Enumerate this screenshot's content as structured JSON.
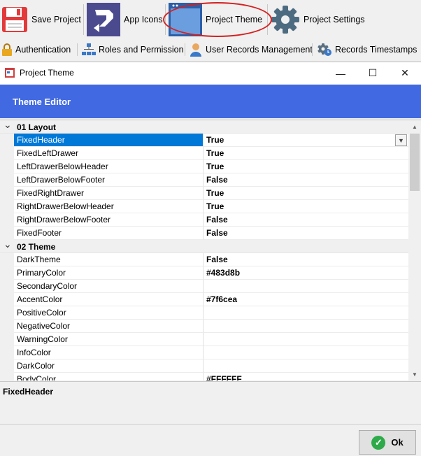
{
  "ribbon": {
    "row1": [
      {
        "label": "Save Project",
        "icon": "floppy-disk-icon"
      },
      {
        "label": "App Icons",
        "icon": "app-icon"
      },
      {
        "label": "Project Theme",
        "icon": "window-theme-icon"
      },
      {
        "label": "Project Settings",
        "icon": "gear-icon"
      }
    ],
    "row2": [
      {
        "label": "Authentication",
        "icon": "lock-icon"
      },
      {
        "label": "Roles and Permission",
        "icon": "org-chart-icon"
      },
      {
        "label": "User Records Management",
        "icon": "user-icon"
      },
      {
        "label": "Records Timestamps",
        "icon": "gear-clock-icon"
      }
    ]
  },
  "dialog": {
    "title": "Project Theme",
    "window_controls": {
      "minimize": "—",
      "maximize": "☐",
      "close": "✕"
    },
    "banner_title": "Theme Editor",
    "banner_color": "#4169e1"
  },
  "grid": {
    "categories": [
      {
        "label": "01 Layout",
        "rows": [
          {
            "name": "FixedHeader",
            "value": "True"
          },
          {
            "name": "FixedLeftDrawer",
            "value": "True"
          },
          {
            "name": "LeftDrawerBelowHeader",
            "value": "True"
          },
          {
            "name": "LeftDrawerBelowFooter",
            "value": "False"
          },
          {
            "name": "FixedRightDrawer",
            "value": "True"
          },
          {
            "name": "RightDrawerBelowHeader",
            "value": "True"
          },
          {
            "name": "RightDrawerBelowFooter",
            "value": "False"
          },
          {
            "name": "FixedFooter",
            "value": "False"
          }
        ]
      },
      {
        "label": "02 Theme",
        "rows": [
          {
            "name": "DarkTheme",
            "value": "False"
          },
          {
            "name": "PrimaryColor",
            "value": "#483d8b"
          },
          {
            "name": "SecondaryColor",
            "value": ""
          },
          {
            "name": "AccentColor",
            "value": "#7f6cea"
          },
          {
            "name": "PositiveColor",
            "value": ""
          },
          {
            "name": "NegativeColor",
            "value": ""
          },
          {
            "name": "WarningColor",
            "value": ""
          },
          {
            "name": "InfoColor",
            "value": ""
          },
          {
            "name": "DarkColor",
            "value": ""
          },
          {
            "name": "BodyColor",
            "value": "#FFFFFF"
          }
        ]
      }
    ],
    "selected_row": "FixedHeader"
  },
  "description": {
    "title": "FixedHeader"
  },
  "footer": {
    "ok_label": "Ok"
  },
  "colors": {
    "selection": "#0078d7",
    "highlight_ring": "#d52020",
    "ok_icon": "#2eaa4a"
  }
}
